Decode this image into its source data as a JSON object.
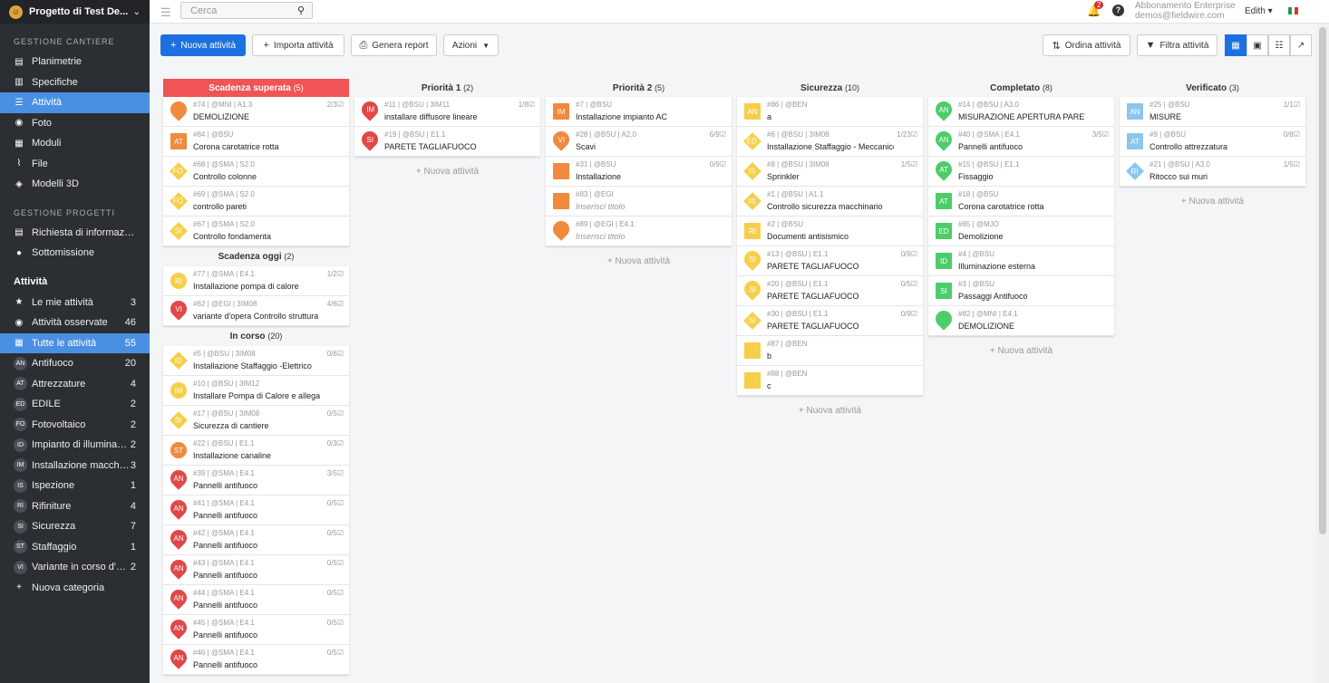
{
  "project": {
    "name": "Progetto di Test De..."
  },
  "sidebar": {
    "sections": [
      {
        "title": "GESTIONE CANTIERE",
        "items": [
          {
            "icon": "blueprint-icon",
            "label": "Planimetrie"
          },
          {
            "icon": "document-icon",
            "label": "Specifiche"
          },
          {
            "icon": "list-icon",
            "label": "Attività",
            "active": true
          },
          {
            "icon": "camera-icon",
            "label": "Foto"
          },
          {
            "icon": "form-icon",
            "label": "Moduli"
          },
          {
            "icon": "paperclip-icon",
            "label": "File"
          },
          {
            "icon": "cube-icon",
            "label": "Modelli 3D"
          }
        ]
      },
      {
        "title": "GESTIONE PROGETTI",
        "items": [
          {
            "icon": "doc-question-icon",
            "label": "Richiesta di informazioni"
          },
          {
            "icon": "person-icon",
            "label": "Sottomissione"
          }
        ]
      }
    ],
    "tasks_header": "Attività",
    "task_items": [
      {
        "icon": "star-icon",
        "label": "Le mie attività",
        "count": "3"
      },
      {
        "icon": "eye-icon",
        "label": "Attività osservate",
        "count": "46"
      },
      {
        "icon": "grid-icon",
        "label": "Tutte le attività",
        "count": "55",
        "active": true
      },
      {
        "badge": "AN",
        "label": "Antifuoco",
        "count": "20"
      },
      {
        "badge": "AT",
        "label": "Attrezzature",
        "count": "4"
      },
      {
        "badge": "ED",
        "label": "EDILE",
        "count": "2"
      },
      {
        "badge": "FO",
        "label": "Fotovoltaico",
        "count": "2"
      },
      {
        "badge": "ID",
        "label": "Impianto di illuminazi...",
        "count": "2"
      },
      {
        "badge": "IM",
        "label": "Installazione macchin...",
        "count": "3"
      },
      {
        "badge": "IS",
        "label": "Ispezione",
        "count": "1"
      },
      {
        "badge": "RI",
        "label": "Rifiniture",
        "count": "4"
      },
      {
        "badge": "SI",
        "label": "Sicurezza",
        "count": "7"
      },
      {
        "badge": "ST",
        "label": "Staffaggio",
        "count": "1"
      },
      {
        "badge": "VI",
        "label": "Variante in corso d'op...",
        "count": "2"
      },
      {
        "icon": "plus-icon",
        "label": "Nuova categoria",
        "count": ""
      }
    ]
  },
  "topbar": {
    "search_placeholder": "Cerca",
    "notifications": "2",
    "help": "?",
    "plan": "Abbonamento Enterprise",
    "email": "demos@fieldwire.com",
    "user": "Edith ▾"
  },
  "toolbar": {
    "new_task": "Nuova attività",
    "import": "Importa attività",
    "report": "Genera report",
    "actions": "Azioni",
    "sort": "Ordina attività",
    "filter": "Filtra attività"
  },
  "colors": {
    "red": "#e04848",
    "orange": "#f08a3c",
    "yellow": "#f6cf4a",
    "green": "#4ccd6a",
    "blue": "#8ec5ee",
    "gray": "#b0b0b0"
  },
  "new_task_link": "+ Nuova attività",
  "columns": [
    {
      "groups": [
        {
          "title": "Scadenza superata",
          "count": "(5)",
          "red": true,
          "cards": [
            {
              "shape": "pin",
              "color": "orange",
              "abbr": "",
              "meta": "#74 | @MNI | A1.3",
              "title": "DEMOLIZIONE",
              "prog": "2/3☑"
            },
            {
              "shape": "sq",
              "color": "orange",
              "abbr": "AT",
              "meta": "#84 | @BSU",
              "title": "Corona carotatrice rotta",
              "prog": ""
            },
            {
              "shape": "dia",
              "color": "yellow",
              "abbr": "FO",
              "meta": "#68 | @SMA | S2.0",
              "title": "Controllo colonne",
              "prog": ""
            },
            {
              "shape": "dia",
              "color": "yellow",
              "abbr": "FO",
              "meta": "#69 | @SMA | S2.0",
              "title": "controllo pareti",
              "prog": ""
            },
            {
              "shape": "dia",
              "color": "yellow",
              "abbr": "SI",
              "meta": "#67 | @SMA | S2.0",
              "title": "Controllo fondamenta",
              "prog": ""
            }
          ]
        },
        {
          "title": "Scadenza oggi",
          "count": "(2)",
          "cards": [
            {
              "shape": "cir",
              "color": "yellow",
              "abbr": "RI",
              "meta": "#77 | @SMA | E4.1",
              "title": "Installazione pompa di calore",
              "prog": "1/2☑"
            },
            {
              "shape": "pin",
              "color": "red",
              "abbr": "VI",
              "meta": "#62 | @EGI | 3IM08",
              "title": "variante d'opera Controllo struttura",
              "prog": "4/6☑"
            }
          ]
        },
        {
          "title": "In corso",
          "count": "(20)",
          "cards": [
            {
              "shape": "dia",
              "color": "yellow",
              "abbr": "ID",
              "meta": "#5 | @BSU | 3IM08",
              "title": "Installazione Staffaggio -Elettrico",
              "prog": "0/6☑"
            },
            {
              "shape": "cir",
              "color": "yellow",
              "abbr": "IM",
              "meta": "#10 | @BSU | 3IM12",
              "title": "Installare Pompa di Calore e allegare foto",
              "prog": ""
            },
            {
              "shape": "dia",
              "color": "yellow",
              "abbr": "SI",
              "meta": "#17 | @BSU | 3IM08",
              "title": "Sicurezza di cantiere",
              "prog": "0/5☑"
            },
            {
              "shape": "cir",
              "color": "orange",
              "abbr": "ST",
              "meta": "#22 | @BSU | E1.1",
              "title": "Installazione canaline",
              "prog": "0/3☑"
            },
            {
              "shape": "pin",
              "color": "red",
              "abbr": "AN",
              "meta": "#39 | @SMA | E4.1",
              "title": "Pannelli antifuoco",
              "prog": "3/5☑"
            },
            {
              "shape": "pin",
              "color": "red",
              "abbr": "AN",
              "meta": "#41 | @SMA | E4.1",
              "title": "Pannelli antifuoco",
              "prog": "0/5☑"
            },
            {
              "shape": "pin",
              "color": "red",
              "abbr": "AN",
              "meta": "#42 | @SMA | E4.1",
              "title": "Pannelli antifuoco",
              "prog": "0/5☑"
            },
            {
              "shape": "pin",
              "color": "red",
              "abbr": "AN",
              "meta": "#43 | @SMA | E4.1",
              "title": "Pannelli antifuoco",
              "prog": "0/5☑"
            },
            {
              "shape": "pin",
              "color": "red",
              "abbr": "AN",
              "meta": "#44 | @SMA | E4.1",
              "title": "Pannelli antifuoco",
              "prog": "0/5☑"
            },
            {
              "shape": "pin",
              "color": "red",
              "abbr": "AN",
              "meta": "#45 | @SMA | E4.1",
              "title": "Pannelli antifuoco",
              "prog": "0/5☑"
            },
            {
              "shape": "pin",
              "color": "red",
              "abbr": "AN",
              "meta": "#46 | @SMA | E4.1",
              "title": "Pannelli antifuoco",
              "prog": "0/5☑"
            }
          ]
        }
      ]
    },
    {
      "groups": [
        {
          "title": "Priorità 1",
          "count": "(2)",
          "cards": [
            {
              "shape": "pin",
              "color": "red",
              "abbr": "IM",
              "meta": "#11 | @BSU | 3IM11",
              "title": "installare diffusore lineare",
              "prog": "1/8☑"
            },
            {
              "shape": "pin",
              "color": "red",
              "abbr": "SI",
              "meta": "#19 | @BSU | E1.1",
              "title": "PARETE TAGLIAFUOCO",
              "prog": ""
            }
          ]
        }
      ],
      "newlink": true
    },
    {
      "groups": [
        {
          "title": "Priorità 2",
          "count": "(5)",
          "cards": [
            {
              "shape": "sq",
              "color": "orange",
              "abbr": "IM",
              "meta": "#7 | @BSU",
              "title": "Installazione impianto AC",
              "prog": ""
            },
            {
              "shape": "pin",
              "color": "orange",
              "abbr": "VI",
              "meta": "#28 | @BSU | A2.0",
              "title": "Scavi",
              "prog": "6/9☑"
            },
            {
              "shape": "sq",
              "color": "orange",
              "abbr": "",
              "meta": "#31 | @BSU",
              "title": "Installazione",
              "prog": "0/9☑"
            },
            {
              "shape": "sq",
              "color": "orange",
              "abbr": "",
              "meta": "#83 | @EGI",
              "title": "Inserisci titolo",
              "italic": true,
              "prog": ""
            },
            {
              "shape": "pin",
              "color": "orange",
              "abbr": "",
              "meta": "#89 | @EGI | E4.1",
              "title": "Inserisci titolo",
              "italic": true,
              "prog": ""
            }
          ]
        }
      ],
      "newlink": true
    },
    {
      "groups": [
        {
          "title": "Sicurezza",
          "count": "(10)",
          "cards": [
            {
              "shape": "sq",
              "color": "yellow",
              "abbr": "AN",
              "meta": "#86 | @BEN",
              "title": "a",
              "prog": ""
            },
            {
              "shape": "dia",
              "color": "yellow",
              "abbr": "ED",
              "meta": "#6 | @BSU | 3IM08",
              "title": "Installazione Staffaggio - Meccanico",
              "prog": "1/23☑"
            },
            {
              "shape": "dia",
              "color": "yellow",
              "abbr": "IS",
              "meta": "#8 | @BSU | 3IM08",
              "title": "Sprinkler",
              "prog": "1/5☑"
            },
            {
              "shape": "dia",
              "color": "yellow",
              "abbr": "RI",
              "meta": "#1 | @BSU | A1.1",
              "title": "Controllo sicurezza macchinario",
              "prog": ""
            },
            {
              "shape": "sq",
              "color": "yellow",
              "abbr": "RI",
              "meta": "#2 | @BSU",
              "title": "Documenti antisismico",
              "prog": ""
            },
            {
              "shape": "pin",
              "color": "yellow",
              "abbr": "SI",
              "meta": "#13 | @BSU | E1.1",
              "title": "PARETE TAGLIAFUOCO",
              "prog": "0/9☑"
            },
            {
              "shape": "pin",
              "color": "yellow",
              "abbr": "SI",
              "meta": "#20 | @BSU | E1.1",
              "title": "PARETE TAGLIAFUOCO",
              "prog": "0/5☑"
            },
            {
              "shape": "dia",
              "color": "yellow",
              "abbr": "SI",
              "meta": "#30 | @BSU | E1.1",
              "title": "PARETE TAGLIAFUOCO",
              "prog": "0/9☑"
            },
            {
              "shape": "sq",
              "color": "yellow",
              "abbr": "",
              "meta": "#87 | @BEN",
              "title": "b",
              "prog": ""
            },
            {
              "shape": "sq",
              "color": "yellow",
              "abbr": "",
              "meta": "#88 | @BEN",
              "title": "c",
              "prog": ""
            }
          ]
        }
      ],
      "newlink": true
    },
    {
      "groups": [
        {
          "title": "Completato",
          "count": "(8)",
          "cards": [
            {
              "shape": "pin",
              "color": "green",
              "abbr": "AN",
              "meta": "#14 | @BSU | A3.0",
              "title": "MISURAZIONE APERTURA PARETE",
              "prog": ""
            },
            {
              "shape": "pin",
              "color": "green",
              "abbr": "AN",
              "meta": "#40 | @SMA | E4.1",
              "title": "Pannelli antifuoco",
              "prog": "3/5☑"
            },
            {
              "shape": "pin",
              "color": "green",
              "abbr": "AT",
              "meta": "#15 | @BSU | E1.1",
              "title": "Fissaggio",
              "prog": ""
            },
            {
              "shape": "sq",
              "color": "green",
              "abbr": "AT",
              "meta": "#18 | @BSU",
              "title": "Corona carotatrice rotta",
              "prog": ""
            },
            {
              "shape": "sq",
              "color": "green",
              "abbr": "ED",
              "meta": "#85 | @MJO",
              "title": "Demolizione",
              "prog": ""
            },
            {
              "shape": "sq",
              "color": "green",
              "abbr": "ID",
              "meta": "#4 | @BSU",
              "title": "Illuminazione esterna",
              "prog": ""
            },
            {
              "shape": "sq",
              "color": "green",
              "abbr": "SI",
              "meta": "#3 | @BSU",
              "title": "Passaggi Antifuoco",
              "prog": ""
            },
            {
              "shape": "pin",
              "color": "green",
              "abbr": "",
              "meta": "#82 | @MNI | E4.1",
              "title": "DEMOLIZIONE",
              "prog": ""
            }
          ]
        }
      ],
      "newlink": true
    },
    {
      "groups": [
        {
          "title": "Verificato",
          "count": "(3)",
          "cards": [
            {
              "shape": "sq",
              "color": "blue",
              "abbr": "AN",
              "meta": "#25 | @BSU",
              "title": "MISURE",
              "prog": "1/1☑"
            },
            {
              "shape": "sq",
              "color": "blue",
              "abbr": "AT",
              "meta": "#9 | @BSU",
              "title": "Controllo attrezzatura",
              "prog": "0/8☑"
            },
            {
              "shape": "dia",
              "color": "blue",
              "abbr": "RI",
              "meta": "#21 | @BSU | A3.0",
              "title": "Ritocco sui muri",
              "prog": "1/5☑"
            }
          ]
        }
      ],
      "newlink": true
    }
  ]
}
